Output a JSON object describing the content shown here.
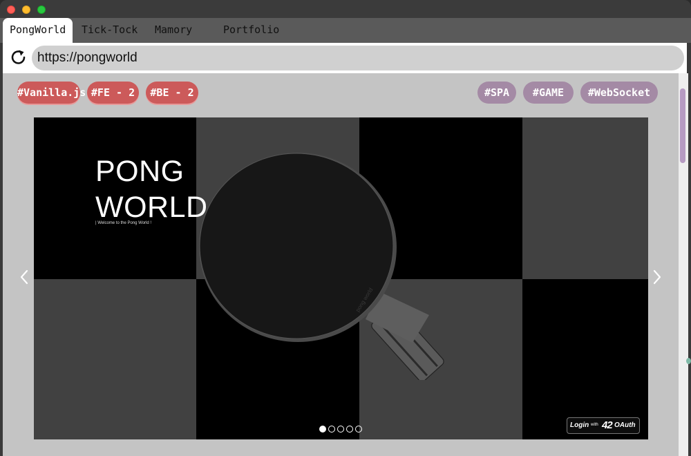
{
  "tabs": [
    {
      "label": "PongWorld",
      "active": true
    },
    {
      "label": "Tick-Tock",
      "active": false
    },
    {
      "label": "Mamory",
      "active": false
    },
    {
      "label": "Portfolio",
      "active": false
    }
  ],
  "address": {
    "url": "https://pongworld"
  },
  "chips_left": [
    "#Vanilla.js",
    "#FE - 2",
    "#BE - 2"
  ],
  "chips_right": [
    "#SPA",
    "#GAME",
    "#WebSocket"
  ],
  "hero": {
    "title": "PONG\nWORLD",
    "subtitle": "| Welcome to the Pong World !",
    "paddle_label": "pong world"
  },
  "carousel": {
    "slide_count": 5,
    "active_index": 0
  },
  "login": {
    "label": "Login",
    "with": "with",
    "brand_number": "42",
    "brand_suffix": "OAuth"
  },
  "colors": {
    "chip_tech": "#cc5a5a",
    "chip_topic": "#a48aa5",
    "content_bg": "#c4c4c4",
    "scroll_thumb": "#b69ac2"
  },
  "icons": [
    "reload-icon",
    "chevron-left-icon",
    "chevron-right-icon",
    "ping-pong-paddle"
  ]
}
